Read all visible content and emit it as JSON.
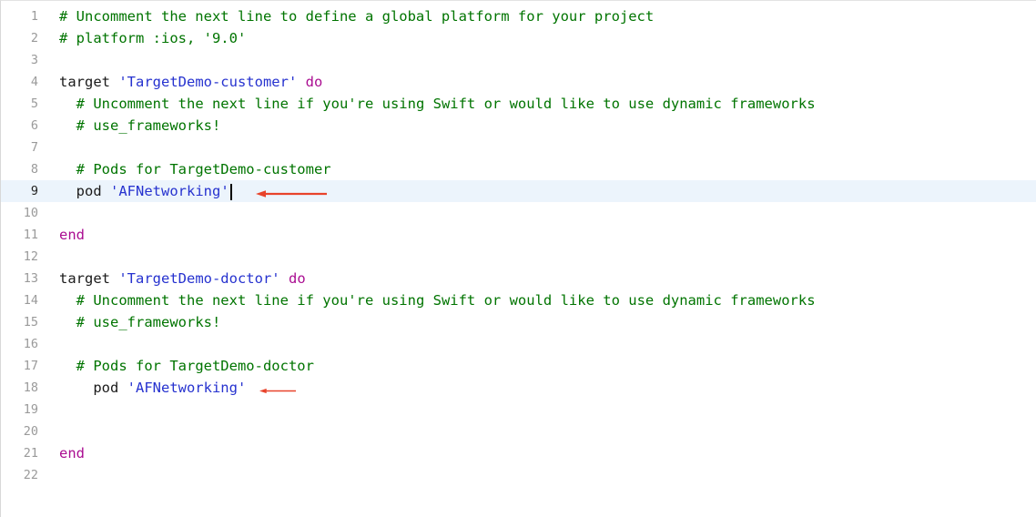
{
  "editor": {
    "current_line": 9,
    "accent_color": "#e8432b",
    "lines": [
      {
        "n": "1",
        "tokens": [
          {
            "t": "comment",
            "v": "# Uncomment the next line to define a global platform for your project"
          }
        ]
      },
      {
        "n": "2",
        "tokens": [
          {
            "t": "comment",
            "v": "# platform :ios, '9.0'"
          }
        ]
      },
      {
        "n": "3",
        "tokens": []
      },
      {
        "n": "4",
        "tokens": [
          {
            "t": "plain",
            "v": "target "
          },
          {
            "t": "string",
            "v": "'TargetDemo-customer'"
          },
          {
            "t": "plain",
            "v": " "
          },
          {
            "t": "keyword",
            "v": "do"
          }
        ]
      },
      {
        "n": "5",
        "tokens": [
          {
            "t": "plain",
            "v": "  "
          },
          {
            "t": "comment",
            "v": "# Uncomment the next line if you're using Swift or would like to use dynamic frameworks"
          }
        ]
      },
      {
        "n": "6",
        "tokens": [
          {
            "t": "plain",
            "v": "  "
          },
          {
            "t": "comment",
            "v": "# use_frameworks!"
          }
        ]
      },
      {
        "n": "7",
        "tokens": []
      },
      {
        "n": "8",
        "tokens": [
          {
            "t": "plain",
            "v": "  "
          },
          {
            "t": "comment",
            "v": "# Pods for TargetDemo-customer"
          }
        ]
      },
      {
        "n": "9",
        "tokens": [
          {
            "t": "plain",
            "v": "  pod "
          },
          {
            "t": "string",
            "v": "'AFNetworking'"
          }
        ]
      },
      {
        "n": "10",
        "tokens": []
      },
      {
        "n": "11",
        "tokens": [
          {
            "t": "keyword",
            "v": "end"
          }
        ]
      },
      {
        "n": "12",
        "tokens": []
      },
      {
        "n": "13",
        "tokens": [
          {
            "t": "plain",
            "v": "target "
          },
          {
            "t": "string",
            "v": "'TargetDemo-doctor'"
          },
          {
            "t": "plain",
            "v": " "
          },
          {
            "t": "keyword",
            "v": "do"
          }
        ]
      },
      {
        "n": "14",
        "tokens": [
          {
            "t": "plain",
            "v": "  "
          },
          {
            "t": "comment",
            "v": "# Uncomment the next line if you're using Swift or would like to use dynamic frameworks"
          }
        ]
      },
      {
        "n": "15",
        "tokens": [
          {
            "t": "plain",
            "v": "  "
          },
          {
            "t": "comment",
            "v": "# use_frameworks!"
          }
        ]
      },
      {
        "n": "16",
        "tokens": []
      },
      {
        "n": "17",
        "tokens": [
          {
            "t": "plain",
            "v": "  "
          },
          {
            "t": "comment",
            "v": "# Pods for TargetDemo-doctor"
          }
        ]
      },
      {
        "n": "18",
        "tokens": [
          {
            "t": "plain",
            "v": "    pod "
          },
          {
            "t": "string",
            "v": "'AFNetworking'"
          }
        ]
      },
      {
        "n": "19",
        "tokens": []
      },
      {
        "n": "20",
        "tokens": []
      },
      {
        "n": "21",
        "tokens": [
          {
            "t": "keyword",
            "v": "end"
          }
        ]
      },
      {
        "n": "22",
        "tokens": []
      }
    ]
  }
}
